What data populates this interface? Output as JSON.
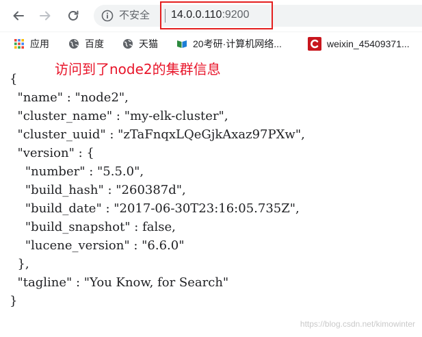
{
  "address_bar": {
    "security_label": "不安全",
    "host": "14.0.0.110",
    "port": ":9200"
  },
  "bookmarks": [
    {
      "label": "应用",
      "icon": "apps-grid-icon"
    },
    {
      "label": "百度",
      "icon": "globe-icon"
    },
    {
      "label": "天猫",
      "icon": "globe-icon"
    },
    {
      "label": "20考研·计算机网络...",
      "icon": "book-icon"
    },
    {
      "label": "weixin_45409371...",
      "icon": "csdn-c-icon"
    }
  ],
  "annotation": "访问到了node2的集群信息",
  "response": {
    "lines": [
      "{",
      "  \"name\" : \"node2\",",
      "  \"cluster_name\" : \"my-elk-cluster\",",
      "  \"cluster_uuid\" : \"zTaFnqxLQeGjkAxaz97PXw\",",
      "  \"version\" : {",
      "    \"number\" : \"5.5.0\",",
      "    \"build_hash\" : \"260387d\",",
      "    \"build_date\" : \"2017-06-30T23:16:05.735Z\",",
      "    \"build_snapshot\" : false,",
      "    \"lucene_version\" : \"6.6.0\"",
      "  },",
      "  \"tagline\" : \"You Know, for Search\"",
      "}"
    ]
  },
  "watermark": "https://blog.csdn.net/kimowinter",
  "colors": {
    "highlight_border": "#e41d1d",
    "annotation": "#e8152a",
    "csdn_red": "#c8161d"
  }
}
